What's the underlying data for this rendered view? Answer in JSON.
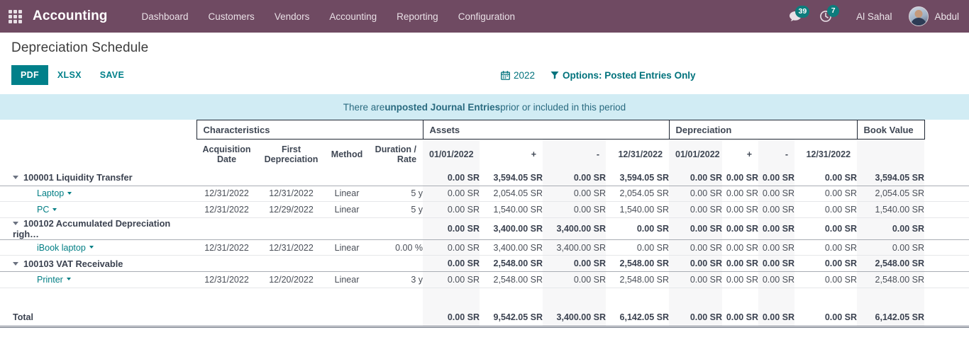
{
  "navbar": {
    "apps_icon": "apps-grid-icon",
    "brand": "Accounting",
    "menu": [
      {
        "label": "Dashboard"
      },
      {
        "label": "Customers"
      },
      {
        "label": "Vendors"
      },
      {
        "label": "Accounting"
      },
      {
        "label": "Reporting"
      },
      {
        "label": "Configuration"
      }
    ],
    "messages_icon": "chat-bubble-icon",
    "messages_count": "39",
    "activities_icon": "clock-icon",
    "activities_count": "7",
    "company": "Al Sahal",
    "user": "Abdul",
    "accent": "#6f4a62"
  },
  "control_panel": {
    "title": "Depreciation Schedule",
    "buttons": [
      {
        "label": "PDF",
        "primary": true
      },
      {
        "label": "XLSX",
        "primary": false
      },
      {
        "label": "SAVE",
        "primary": false
      }
    ],
    "date_filter": {
      "icon": "calendar-icon",
      "label": "2022"
    },
    "options_filter": {
      "icon": "filter-icon",
      "label": "Options: Posted Entries Only"
    },
    "primary_color": "#00808a"
  },
  "banner": {
    "prefix": "There are ",
    "emphasis": "unposted Journal Entries",
    "suffix": " prior or included in this period",
    "background": "#d1ecf4"
  },
  "table": {
    "bands": [
      {
        "label": "Characteristics"
      },
      {
        "label": "Assets"
      },
      {
        "label": "Depreciation"
      },
      {
        "label": "Book Value"
      }
    ],
    "columns": [
      {
        "key": "name",
        "label": ""
      },
      {
        "key": "acquisition_date",
        "label": "Acquisition Date"
      },
      {
        "key": "first_depreciation",
        "label": "First Depreciation"
      },
      {
        "key": "method",
        "label": "Method"
      },
      {
        "key": "duration_rate",
        "label": "Duration / Rate"
      },
      {
        "key": "assets_open",
        "label": "01/01/2022"
      },
      {
        "key": "assets_plus",
        "label": "+"
      },
      {
        "key": "assets_minus",
        "label": "-"
      },
      {
        "key": "assets_close",
        "label": "12/31/2022"
      },
      {
        "key": "depr_open",
        "label": "01/01/2022"
      },
      {
        "key": "depr_plus",
        "label": "+"
      },
      {
        "key": "depr_minus",
        "label": "-"
      },
      {
        "key": "depr_close",
        "label": "12/31/2022"
      },
      {
        "key": "book_value",
        "label": ""
      }
    ],
    "rows": [
      {
        "type": "group",
        "caret": "caret-down-icon",
        "name": "100001 Liquidity Transfer",
        "acquisition_date": "",
        "first_depreciation": "",
        "method": "",
        "duration_rate": "",
        "assets_open": "0.00 SR",
        "assets_plus": "3,594.05 SR",
        "assets_minus": "0.00 SR",
        "assets_close": "3,594.05 SR",
        "depr_open": "0.00 SR",
        "depr_plus": "0.00 SR",
        "depr_minus": "0.00 SR",
        "depr_close": "0.00 SR",
        "book_value": "3,594.05 SR"
      },
      {
        "type": "leaf",
        "name": "Laptop",
        "acquisition_date": "12/31/2022",
        "first_depreciation": "12/31/2022",
        "method": "Linear",
        "duration_rate": "5 y",
        "assets_open": "0.00 SR",
        "assets_plus": "2,054.05 SR",
        "assets_minus": "0.00 SR",
        "assets_close": "2,054.05 SR",
        "depr_open": "0.00 SR",
        "depr_plus": "0.00 SR",
        "depr_minus": "0.00 SR",
        "depr_close": "0.00 SR",
        "book_value": "2,054.05 SR"
      },
      {
        "type": "leaf",
        "name": "PC",
        "acquisition_date": "12/31/2022",
        "first_depreciation": "12/29/2022",
        "method": "Linear",
        "duration_rate": "5 y",
        "assets_open": "0.00 SR",
        "assets_plus": "1,540.00 SR",
        "assets_minus": "0.00 SR",
        "assets_close": "1,540.00 SR",
        "depr_open": "0.00 SR",
        "depr_plus": "0.00 SR",
        "depr_minus": "0.00 SR",
        "depr_close": "0.00 SR",
        "book_value": "1,540.00 SR"
      },
      {
        "type": "group",
        "caret": "caret-down-icon",
        "name": "100102 Accumulated Depreciation righ…",
        "acquisition_date": "",
        "first_depreciation": "",
        "method": "",
        "duration_rate": "",
        "assets_open": "0.00 SR",
        "assets_plus": "3,400.00 SR",
        "assets_minus": "3,400.00 SR",
        "assets_close": "0.00 SR",
        "depr_open": "0.00 SR",
        "depr_plus": "0.00 SR",
        "depr_minus": "0.00 SR",
        "depr_close": "0.00 SR",
        "book_value": "0.00 SR"
      },
      {
        "type": "leaf",
        "name": "iBook laptop",
        "acquisition_date": "12/31/2022",
        "first_depreciation": "12/31/2022",
        "method": "Linear",
        "duration_rate": "0.00 %",
        "assets_open": "0.00 SR",
        "assets_plus": "3,400.00 SR",
        "assets_minus": "3,400.00 SR",
        "assets_close": "0.00 SR",
        "depr_open": "0.00 SR",
        "depr_plus": "0.00 SR",
        "depr_minus": "0.00 SR",
        "depr_close": "0.00 SR",
        "book_value": "0.00 SR"
      },
      {
        "type": "group",
        "caret": "caret-down-icon",
        "name": "100103 VAT Receivable",
        "acquisition_date": "",
        "first_depreciation": "",
        "method": "",
        "duration_rate": "",
        "assets_open": "0.00 SR",
        "assets_plus": "2,548.00 SR",
        "assets_minus": "0.00 SR",
        "assets_close": "2,548.00 SR",
        "depr_open": "0.00 SR",
        "depr_plus": "0.00 SR",
        "depr_minus": "0.00 SR",
        "depr_close": "0.00 SR",
        "book_value": "2,548.00 SR"
      },
      {
        "type": "leaf",
        "name": "Printer",
        "acquisition_date": "12/31/2022",
        "first_depreciation": "12/20/2022",
        "method": "Linear",
        "duration_rate": "3 y",
        "assets_open": "0.00 SR",
        "assets_plus": "2,548.00 SR",
        "assets_minus": "0.00 SR",
        "assets_close": "2,548.00 SR",
        "depr_open": "0.00 SR",
        "depr_plus": "0.00 SR",
        "depr_minus": "0.00 SR",
        "depr_close": "0.00 SR",
        "book_value": "2,548.00 SR"
      }
    ],
    "total": {
      "name": "Total",
      "acquisition_date": "",
      "first_depreciation": "",
      "method": "",
      "duration_rate": "",
      "assets_open": "0.00 SR",
      "assets_plus": "9,542.05 SR",
      "assets_minus": "3,400.00 SR",
      "assets_close": "6,142.05 SR",
      "depr_open": "0.00 SR",
      "depr_plus": "0.00 SR",
      "depr_minus": "0.00 SR",
      "depr_close": "0.00 SR",
      "book_value": "6,142.05 SR"
    }
  }
}
